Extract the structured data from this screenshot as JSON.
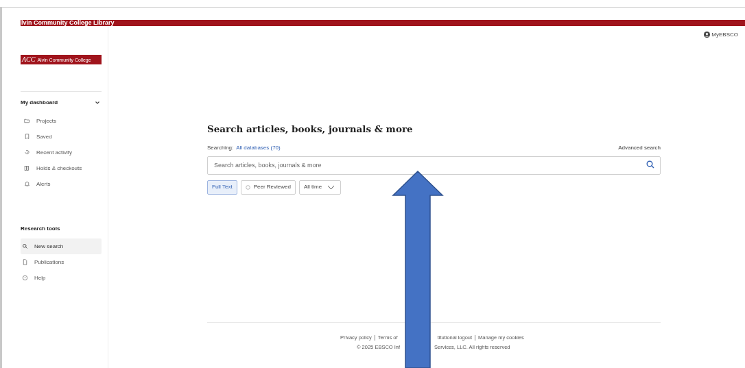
{
  "banner": {
    "title": "lvin Community College Library"
  },
  "logo": {
    "mark": "ACC",
    "name": "Alvin Community College"
  },
  "header": {
    "account": "MyEBSCO"
  },
  "sidebar": {
    "sections": [
      {
        "title": "My dashboard",
        "expanded": true,
        "items": [
          {
            "label": "Projects",
            "selected": false
          },
          {
            "label": "Saved",
            "selected": false
          },
          {
            "label": "Recent activity",
            "selected": false
          },
          {
            "label": "Holds & checkouts",
            "selected": false
          },
          {
            "label": "Alerts",
            "selected": false
          }
        ]
      },
      {
        "title": "Research tools",
        "items": [
          {
            "label": "New search",
            "selected": true
          },
          {
            "label": "Publications",
            "selected": false
          },
          {
            "label": "Help",
            "selected": false
          }
        ]
      }
    ]
  },
  "search": {
    "heading": "Search articles, books, journals & more",
    "searching_label": "Searching:",
    "databases": "All databases (70)",
    "advanced": "Advanced search",
    "placeholder": "Search articles, books, journals & more",
    "filters": [
      {
        "kind": "toggle",
        "label": "Full Text",
        "selected": true
      },
      {
        "kind": "radio",
        "label": "Peer Reviewed",
        "selected": false
      },
      {
        "kind": "dropdown",
        "label": "All time",
        "selected": false
      }
    ]
  },
  "footer": {
    "links": [
      "Privacy policy",
      "Terms of",
      "titutional logout",
      "Manage my cookies"
    ],
    "copyright": [
      "© 2025 EBSCO Inf",
      "Services, LLC. All rights reserved"
    ]
  }
}
